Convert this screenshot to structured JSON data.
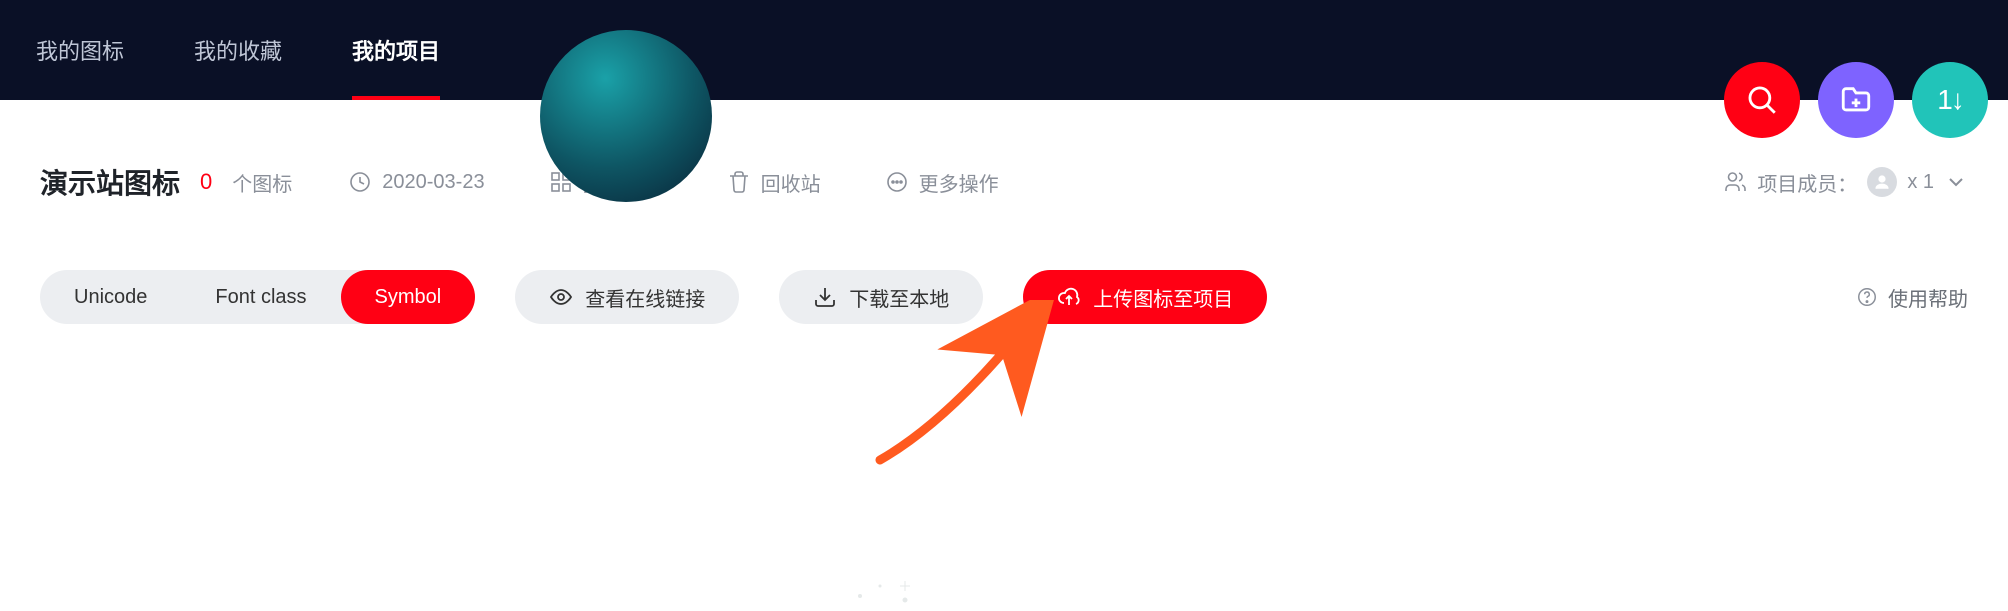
{
  "nav": {
    "tabs": [
      {
        "label": "我的图标",
        "active": false
      },
      {
        "label": "我的收藏",
        "active": false
      },
      {
        "label": "我的项目",
        "active": true
      }
    ]
  },
  "avatar_text": "1↓",
  "project": {
    "title": "演示站图标",
    "count": "0",
    "count_suffix": "个图标",
    "date": "2020-03-23",
    "batch_op": "批量操作",
    "recycle": "回收站",
    "more_op": "更多操作",
    "members_label": "项目成员：",
    "members_count": "x 1"
  },
  "modes": {
    "items": [
      {
        "label": "Unicode",
        "active": false
      },
      {
        "label": "Font class",
        "active": false
      },
      {
        "label": "Symbol",
        "active": true
      }
    ]
  },
  "actions": {
    "view_online": "查看在线链接",
    "download_local": "下载至本地",
    "upload_project": "上传图标至项目",
    "help": "使用帮助"
  }
}
